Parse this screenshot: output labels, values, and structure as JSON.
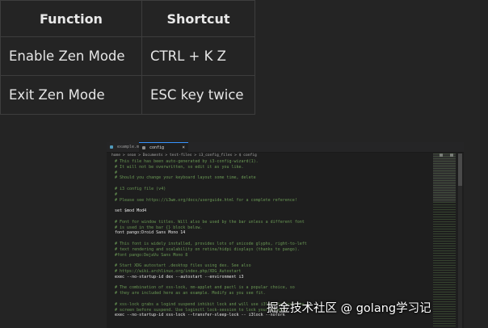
{
  "table": {
    "headers": [
      "Function",
      "Shortcut"
    ],
    "rows": [
      {
        "function": "Enable Zen Mode",
        "shortcut": "CTRL + K Z"
      },
      {
        "function": "Exit Zen Mode",
        "shortcut": "ESC key twice"
      }
    ]
  },
  "editor": {
    "tabs": [
      {
        "label": "example.md"
      },
      {
        "label": "config"
      }
    ],
    "active_tab_close": "×",
    "breadcrumb": "home > sean > Documents > test-files > i3_config_files > $ config",
    "lines": [
      {
        "text": "# This file has been auto-generated by i3-config-wizard(1).",
        "kind": "comment"
      },
      {
        "text": "# It will not be overwritten, so edit it as you like.",
        "kind": "comment"
      },
      {
        "text": "#",
        "kind": "comment"
      },
      {
        "text": "# Should you change your keyboard layout some time, delete",
        "kind": "comment"
      },
      {
        "text": "",
        "kind": "blank"
      },
      {
        "text": "# i3 config file (v4)",
        "kind": "comment"
      },
      {
        "text": "#",
        "kind": "comment"
      },
      {
        "text": "# Please see https://i3wm.org/docs/userguide.html for a complete reference!",
        "kind": "comment"
      },
      {
        "text": "",
        "kind": "blank"
      },
      {
        "text": "set $mod Mod4",
        "kind": "keyword"
      },
      {
        "text": "",
        "kind": "blank"
      },
      {
        "text": "# Font for window titles. Will also be used by the bar unless a different font",
        "kind": "comment"
      },
      {
        "text": "# is used in the bar {} block below.",
        "kind": "comment"
      },
      {
        "text": "font pango:Droid Sans Mono 14",
        "kind": "keyword"
      },
      {
        "text": "",
        "kind": "blank"
      },
      {
        "text": "# This font is widely installed, provides lots of unicode glyphs, right-to-left",
        "kind": "comment"
      },
      {
        "text": "# text rendering and scalability on retina/hidpi displays (thanks to pango).",
        "kind": "comment"
      },
      {
        "text": "#font pango:DejaVu Sans Mono 8",
        "kind": "comment"
      },
      {
        "text": "",
        "kind": "blank"
      },
      {
        "text": "# Start XDG autostart .desktop files using dex. See also",
        "kind": "comment"
      },
      {
        "text": "# https://wiki.archlinux.org/index.php/XDG_Autostart",
        "kind": "comment"
      },
      {
        "text": "exec --no-startup-id dex --autostart --environment i3",
        "kind": "keyword"
      },
      {
        "text": "",
        "kind": "blank"
      },
      {
        "text": "# The combination of xss-lock, nm-applet and pactl is a popular choice, so",
        "kind": "comment"
      },
      {
        "text": "# they are included here as an example. Modify as you see fit.",
        "kind": "comment"
      },
      {
        "text": "",
        "kind": "blank"
      },
      {
        "text": "# xss-lock grabs a logind suspend inhibit lock and will use i3lock to lock the",
        "kind": "comment"
      },
      {
        "text": "# screen before suspend. Use loginctl lock-session to lock your screen.",
        "kind": "comment"
      },
      {
        "text": "exec --no-startup-id xss-lock --transfer-sleep-lock -- i3lock --nofork",
        "kind": "keyword"
      }
    ]
  },
  "watermark": "掘金技术社区 @ golang学习记",
  "colors": {
    "background": "#242424",
    "editor_bg": "#1e1e1e",
    "comment": "#6a9955",
    "accent": "#3794ff"
  }
}
